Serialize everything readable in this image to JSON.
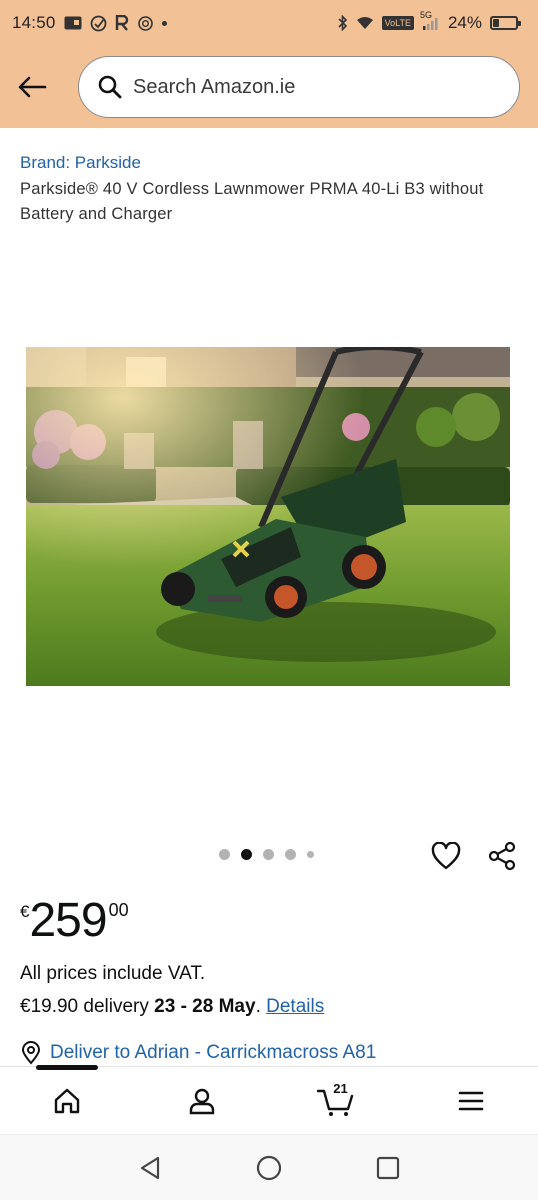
{
  "status_bar": {
    "time": "14:50",
    "network_label": "VoLTE",
    "signal_label": "5G",
    "battery_text": "24%",
    "battery_level": 0.24
  },
  "header": {
    "search_placeholder": "Search Amazon.ie"
  },
  "product": {
    "brand": "Brand: Parkside",
    "title": "Parkside® 40 V Cordless Lawnmower PRMA 40-Li B3 without Battery and Charger",
    "image_alt": "Parkside cordless lawnmower on a lawn",
    "carousel": {
      "total_dots": 5,
      "active_index": 1
    }
  },
  "price": {
    "symbol": "€",
    "whole": "259",
    "fraction": "00"
  },
  "vat_text": "All prices include VAT.",
  "delivery": {
    "prefix": "€19.90 delivery",
    "dates": "23 - 28 May",
    "period": ".",
    "details_link": "Details"
  },
  "deliver_to": "Deliver to Adrian - Carrickmacross A81",
  "bottom_nav": {
    "cart_count": "21",
    "items": [
      "home-icon",
      "account-icon",
      "cart-icon",
      "menu-icon"
    ]
  },
  "colors": {
    "header_bg": "#f3c196",
    "link": "#2163a7",
    "text": "#0f1111"
  }
}
